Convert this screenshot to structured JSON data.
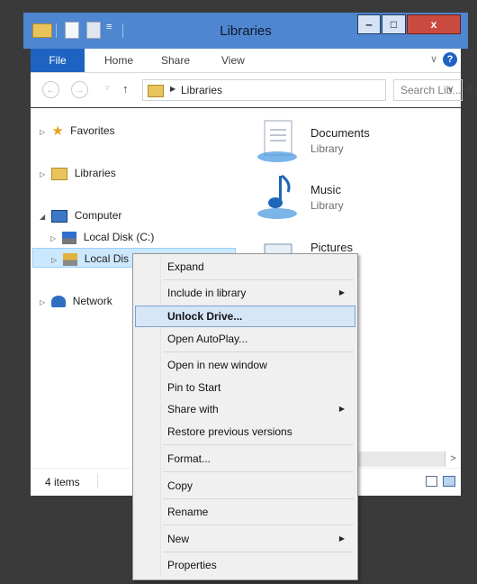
{
  "window": {
    "title": "Libraries"
  },
  "ribbon": {
    "tabs": [
      {
        "label": "File"
      },
      {
        "label": "Home"
      },
      {
        "label": "Share"
      },
      {
        "label": "View"
      }
    ],
    "expand_glyph": "∨",
    "help_glyph": "?"
  },
  "titlebar": {
    "minimize_glyph": "‒",
    "maximize_glyph": "□",
    "close_glyph": "x",
    "qa_dropdown_glyph": "≡"
  },
  "address_bar": {
    "back_glyph": "←",
    "forward_glyph": "→",
    "dropdown_glyph": "▿",
    "up_glyph": "↑",
    "crumb_arrow": "▶",
    "path": "Libraries",
    "path_dropdown": "∨",
    "refresh_glyph": "↻",
    "search_placeholder": "Search Lib..."
  },
  "nav_pane": {
    "expand_glyph": "▷",
    "expanded_glyph": "◢",
    "items": [
      {
        "label": "Favorites"
      },
      {
        "label": "Libraries"
      },
      {
        "label": "Computer"
      },
      {
        "label": "Local Disk (C:)"
      },
      {
        "label": "Local Dis"
      },
      {
        "label": "Network"
      }
    ]
  },
  "content": {
    "libraries": [
      {
        "name": "Documents",
        "type": "Library"
      },
      {
        "name": "Music",
        "type": "Library"
      },
      {
        "name": "Pictures",
        "type": ""
      }
    ]
  },
  "status_bar": {
    "item_count": "4 items"
  },
  "scrollbar": {
    "right_glyph": ">"
  },
  "context_menu": {
    "submenu_glyph": "▶",
    "items": [
      {
        "label": "Expand"
      },
      {
        "label": "Include in library"
      },
      {
        "label": "Unlock Drive..."
      },
      {
        "label": "Open AutoPlay..."
      },
      {
        "label": "Open in new window"
      },
      {
        "label": "Pin to Start"
      },
      {
        "label": "Share with"
      },
      {
        "label": "Restore previous versions"
      },
      {
        "label": "Format..."
      },
      {
        "label": "Copy"
      },
      {
        "label": "Rename"
      },
      {
        "label": "New"
      },
      {
        "label": "Properties"
      }
    ]
  },
  "colors": {
    "title_bar": "#4f86d0",
    "file_tab": "#1f63c2",
    "close_button": "#c94a3f",
    "menu_highlight": "#d5e6f7"
  }
}
